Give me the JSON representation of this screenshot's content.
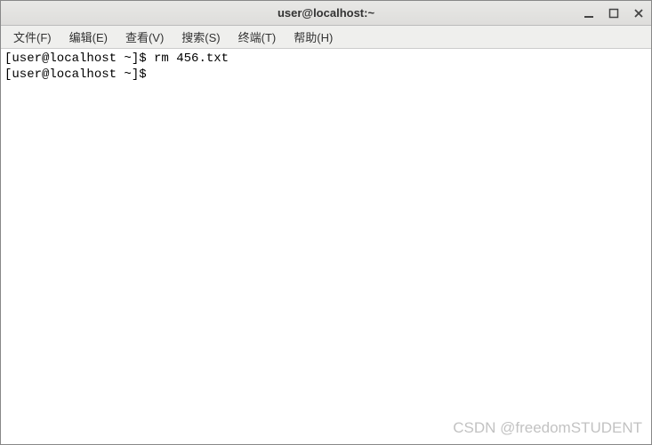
{
  "titlebar": {
    "title": "user@localhost:~"
  },
  "menubar": {
    "items": [
      {
        "label": "文件(F)"
      },
      {
        "label": "编辑(E)"
      },
      {
        "label": "查看(V)"
      },
      {
        "label": "搜索(S)"
      },
      {
        "label": "终端(T)"
      },
      {
        "label": "帮助(H)"
      }
    ]
  },
  "terminal": {
    "lines": [
      {
        "prompt": "[user@localhost ~]$ ",
        "command": "rm 456.txt"
      },
      {
        "prompt": "[user@localhost ~]$ ",
        "command": ""
      }
    ]
  },
  "watermark": "CSDN @freedomSTUDENT"
}
